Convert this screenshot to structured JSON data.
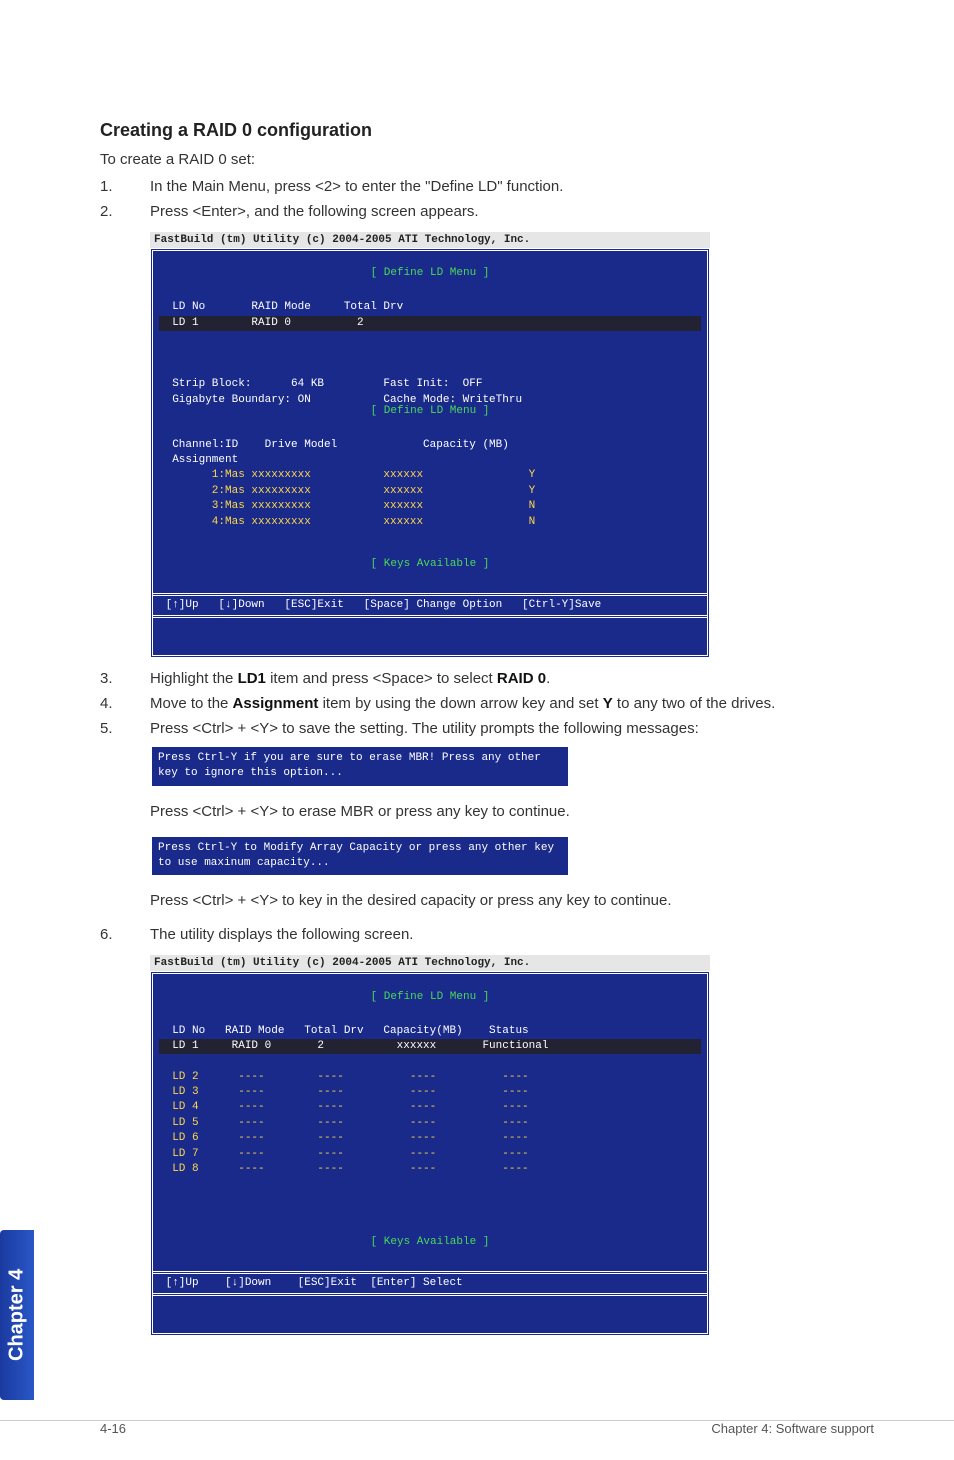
{
  "section_title": "Creating a RAID 0 configuration",
  "lead": "To create a RAID 0 set:",
  "step1": "In the Main Menu, press <2> to enter the \"Define LD\" function.",
  "step2": "Press <Enter>, and the following screen appears.",
  "terminal_header": "FastBuild (tm) Utility (c) 2004-2005 ATI Technology, Inc.",
  "t1": {
    "menu_label": "[ Define LD Menu ]",
    "row_header": "  LD No       RAID Mode     Total Drv",
    "row_sel": "  LD 1        RAID 0          2",
    "cfg1": "  Strip Block:      64 KB         Fast Init:  OFF",
    "cfg2": "  Gigabyte Boundary: ON           Cache Mode: WriteThru",
    "drive_label": "[ Define LD Menu ]",
    "drive_hdr": "  Channel:ID    Drive Model             Capacity (MB)",
    "drive_asg": "  Assignment",
    "d1": "        1:Mas xxxxxxxxx           xxxxxx                Y",
    "d2": "        2:Mas xxxxxxxxx           xxxxxx                Y",
    "d3": "        3:Mas xxxxxxxxx           xxxxxx                N",
    "d4": "        4:Mas xxxxxxxxx           xxxxxx                N",
    "keys_label": "[ Keys Available ]",
    "keys": " [↑]Up   [↓]Down   [ESC]Exit   [Space] Change Option   [Ctrl-Y]Save"
  },
  "step3_pre": "Highlight the ",
  "step3_b1": "LD1",
  "step3_mid": " item and press <Space> to select ",
  "step3_b2": "RAID 0",
  "step3_post": ".",
  "step4_pre": "Move to the ",
  "step4_b1": "Assignment",
  "step4_mid": " item by using the down arrow key and set ",
  "step4_b2": "Y",
  "step4_post": " to any two of the drives.",
  "step5": "Press <Ctrl> + <Y> to save the setting. The utility prompts the following messages:",
  "msg1": "Press Ctrl-Y if you are sure to erase MBR! Press any other key to ignore this option...",
  "after_msg1": "Press <Ctrl> + <Y> to erase MBR or press any key to continue.",
  "msg2": "Press Ctrl-Y to Modify Array Capacity or press any other key to use maxinum capacity...",
  "after_msg2": "Press <Ctrl> + <Y> to key in the desired capacity or press any key to continue.",
  "step6": "The utility displays the following screen.",
  "t2": {
    "menu_label": "[ Define LD Menu ]",
    "hdr": "  LD No   RAID Mode   Total Drv   Capacity(MB)    Status",
    "r1": "  LD 1     RAID 0       2           xxxxxx       Functional",
    "r2": "  LD 2      ----        ----          ----          ----",
    "r3": "  LD 3      ----        ----          ----          ----",
    "r4": "  LD 4      ----        ----          ----          ----",
    "r5": "  LD 5      ----        ----          ----          ----",
    "r6": "  LD 6      ----        ----          ----          ----",
    "r7": "  LD 7      ----        ----          ----          ----",
    "r8": "  LD 8      ----        ----          ----          ----",
    "keys_label": "[ Keys Available ]",
    "keys": " [↑]Up    [↓]Down    [ESC]Exit  [Enter] Select"
  },
  "side_tab": "Chapter 4",
  "footer_left": "4-16",
  "footer_right": "Chapter 4: Software support"
}
